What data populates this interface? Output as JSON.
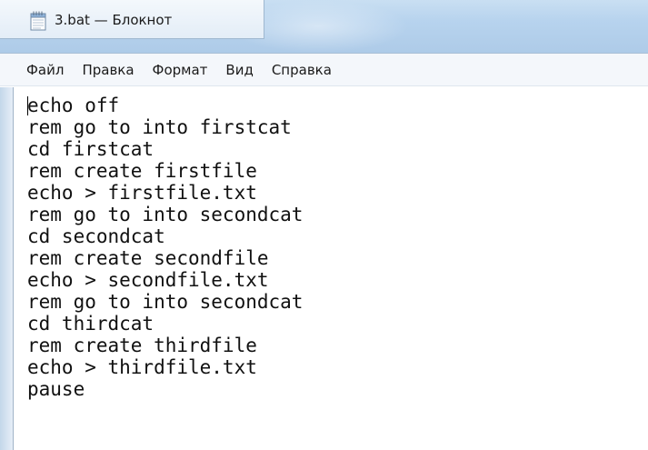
{
  "window": {
    "title": "3.bat — Блокнот"
  },
  "menu": {
    "items": [
      "Файл",
      "Правка",
      "Формат",
      "Вид",
      "Справка"
    ]
  },
  "editor": {
    "lines": [
      "echo off",
      "rem go to into firstcat",
      "cd firstcat",
      "rem create firstfile",
      "echo > firstfile.txt",
      "rem go to into secondcat",
      "cd secondcat",
      "rem create secondfile",
      "echo > secondfile.txt",
      "rem go to into secondcat",
      "cd thirdcat",
      "rem create thirdfile",
      "echo > thirdfile.txt",
      "pause"
    ]
  },
  "icons": {
    "app_icon": "notepad-icon"
  },
  "colors": {
    "titlebar": "#b7d3ee",
    "menubar": "#f4f7fb",
    "text": "#111111"
  }
}
